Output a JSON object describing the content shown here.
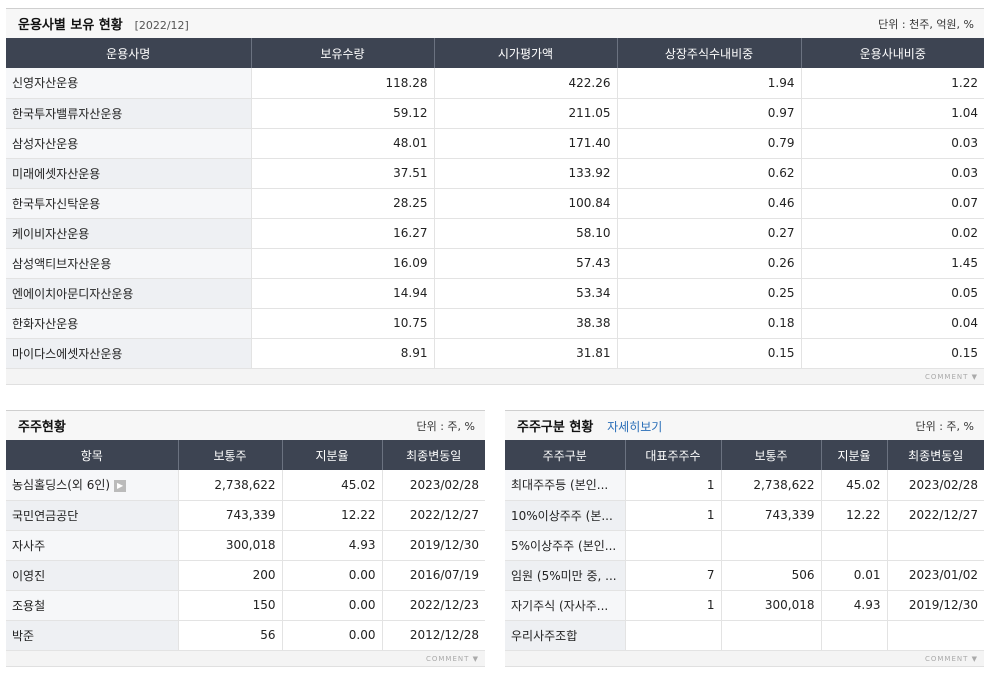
{
  "panel1": {
    "title": "운용사별 보유 현황",
    "period": "[2022/12]",
    "unit": "단위 : 천주, 억원, %",
    "columns": [
      "운용사명",
      "보유수량",
      "시가평가액",
      "상장주식수내비중",
      "운용사내비중"
    ],
    "rows": [
      [
        "신영자산운용",
        "118.28",
        "422.26",
        "1.94",
        "1.22"
      ],
      [
        "한국투자밸류자산운용",
        "59.12",
        "211.05",
        "0.97",
        "1.04"
      ],
      [
        "삼성자산운용",
        "48.01",
        "171.40",
        "0.79",
        "0.03"
      ],
      [
        "미래에셋자산운용",
        "37.51",
        "133.92",
        "0.62",
        "0.03"
      ],
      [
        "한국투자신탁운용",
        "28.25",
        "100.84",
        "0.46",
        "0.07"
      ],
      [
        "케이비자산운용",
        "16.27",
        "58.10",
        "0.27",
        "0.02"
      ],
      [
        "삼성액티브자산운용",
        "16.09",
        "57.43",
        "0.26",
        "1.45"
      ],
      [
        "엔에이치아문디자산운용",
        "14.94",
        "53.34",
        "0.25",
        "0.05"
      ],
      [
        "한화자산운용",
        "10.75",
        "38.38",
        "0.18",
        "0.04"
      ],
      [
        "마이다스에셋자산운용",
        "8.91",
        "31.81",
        "0.15",
        "0.15"
      ]
    ],
    "comment": "COMMENT ▼"
  },
  "panel2": {
    "title": "주주현황",
    "unit": "단위 : 주, %",
    "columns": [
      "항목",
      "보통주",
      "지분율",
      "최종변동일"
    ],
    "rows": [
      [
        "농심홀딩스(외 6인)",
        "2,738,622",
        "45.02",
        "2023/02/28"
      ],
      [
        "국민연금공단",
        "743,339",
        "12.22",
        "2022/12/27"
      ],
      [
        "자사주",
        "300,018",
        "4.93",
        "2019/12/30"
      ],
      [
        "이영진",
        "200",
        "0.00",
        "2016/07/19"
      ],
      [
        "조용철",
        "150",
        "0.00",
        "2022/12/23"
      ],
      [
        "박준",
        "56",
        "0.00",
        "2012/12/28"
      ]
    ],
    "comment": "COMMENT ▼"
  },
  "panel3": {
    "title": "주주구분 현황",
    "link": "자세히보기",
    "unit": "단위 : 주, %",
    "columns": [
      "주주구분",
      "대표주주수",
      "보통주",
      "지분율",
      "최종변동일"
    ],
    "rows": [
      [
        "최대주주등 (본인...",
        "1",
        "2,738,622",
        "45.02",
        "2023/02/28"
      ],
      [
        "10%이상주주 (본...",
        "1",
        "743,339",
        "12.22",
        "2022/12/27"
      ],
      [
        "5%이상주주 (본인...",
        "",
        "",
        "",
        ""
      ],
      [
        "임원 (5%미만 중, ...",
        "7",
        "506",
        "0.01",
        "2023/01/02"
      ],
      [
        "자기주식 (자사주...",
        "1",
        "300,018",
        "4.93",
        "2019/12/30"
      ],
      [
        "우리사주조합",
        "",
        "",
        "",
        ""
      ]
    ],
    "comment": "COMMENT ▼"
  }
}
